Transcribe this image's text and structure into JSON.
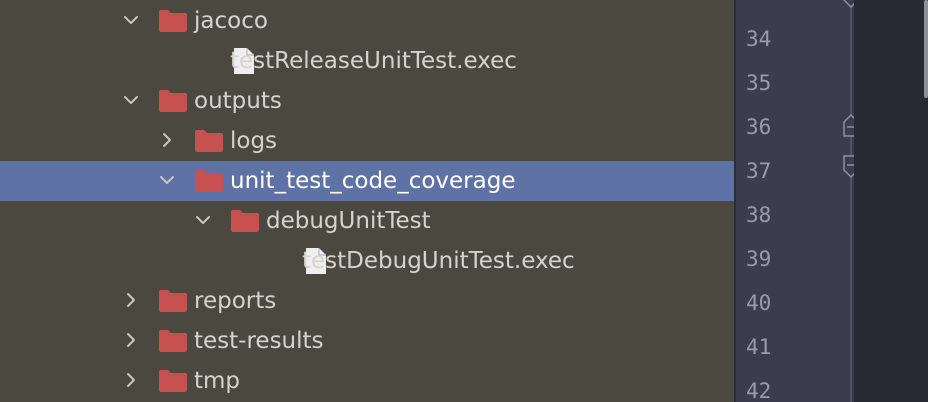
{
  "tree": {
    "items": [
      {
        "label": "jacoco",
        "type": "folder",
        "level": 0,
        "expanded": true,
        "selected": false
      },
      {
        "label": "testReleaseUnitTest.exec",
        "type": "file",
        "level": 1,
        "expanded": false,
        "selected": false
      },
      {
        "label": "outputs",
        "type": "folder",
        "level": 0,
        "expanded": true,
        "selected": false
      },
      {
        "label": "logs",
        "type": "folder",
        "level": 1,
        "expanded": false,
        "selected": false
      },
      {
        "label": "unit_test_code_coverage",
        "type": "folder",
        "level": 1,
        "expanded": true,
        "selected": true
      },
      {
        "label": "debugUnitTest",
        "type": "folder",
        "level": 2,
        "expanded": true,
        "selected": false
      },
      {
        "label": "testDebugUnitTest.exec",
        "type": "file",
        "level": 3,
        "expanded": false,
        "selected": false
      },
      {
        "label": "reports",
        "type": "folder",
        "level": 0,
        "expanded": false,
        "selected": false
      },
      {
        "label": "test-results",
        "type": "folder",
        "level": 0,
        "expanded": false,
        "selected": false
      },
      {
        "label": "tmp",
        "type": "folder",
        "level": 0,
        "expanded": false,
        "selected": false
      }
    ]
  },
  "gutter": {
    "line_numbers": [
      "34",
      "35",
      "36",
      "37",
      "38",
      "39",
      "40",
      "41",
      "42"
    ]
  },
  "colors": {
    "folder": "#c7514f",
    "file": "#eeeeee",
    "selection": "#5f72a6",
    "panel_bg": "#4b4840",
    "gutter_bg": "#3b3d4d"
  },
  "icons": {
    "folder": "folder-icon",
    "file": "file-icon",
    "expanded": "chevron-down-icon",
    "collapsed": "chevron-right-icon",
    "fold_start": "fold-collapse-icon",
    "fold_end": "fold-end-icon"
  }
}
